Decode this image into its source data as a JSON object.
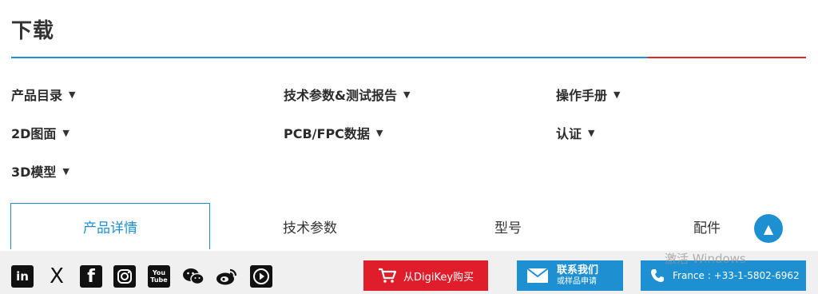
{
  "section_title": "下载",
  "downloads": [
    {
      "label": "产品目录"
    },
    {
      "label": "技术参数&测试报告"
    },
    {
      "label": "操作手册"
    },
    {
      "label": "2D图面"
    },
    {
      "label": "PCB/FPC数据"
    },
    {
      "label": "认证"
    },
    {
      "label": "3D模型"
    }
  ],
  "caret": "▼",
  "tabs": [
    {
      "label": "产品详情",
      "active": true
    },
    {
      "label": "技术参数"
    },
    {
      "label": "型号"
    },
    {
      "label": "配件"
    }
  ],
  "scroll_top": "▲",
  "social": [
    {
      "name": "linkedin-icon",
      "glyph": "in"
    },
    {
      "name": "x-twitter-icon",
      "glyph": "X"
    },
    {
      "name": "facebook-icon",
      "glyph": "f"
    },
    {
      "name": "instagram-icon",
      "glyph": ""
    },
    {
      "name": "youtube-icon",
      "glyph": "You\nTube"
    },
    {
      "name": "wechat-icon",
      "glyph": ""
    },
    {
      "name": "weibo-icon",
      "glyph": ""
    },
    {
      "name": "video-play-icon",
      "glyph": ""
    }
  ],
  "footer": {
    "buy_label": "从DigiKey购买",
    "contact_label": "联系我们",
    "contact_sub": "或样品申请",
    "phone_label": "France : +33-1-5802-6962"
  },
  "watermark": "激活 Windows",
  "colors": {
    "accent": "#1e90d2",
    "red": "#e01e2b"
  }
}
